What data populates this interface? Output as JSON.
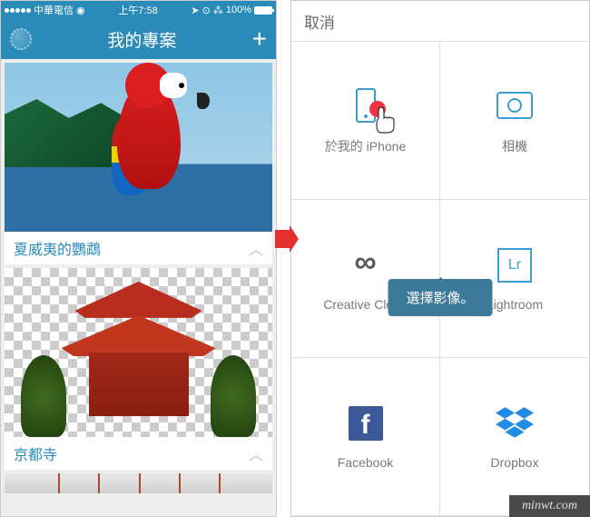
{
  "status": {
    "carrier": "中華電信",
    "wifi": "⋮",
    "time": "上午7:58",
    "battery_pct": "100%"
  },
  "left": {
    "title": "我的專案",
    "projects": [
      {
        "title": "夏威夷的鸚鵡"
      },
      {
        "title": "京都寺"
      }
    ]
  },
  "right": {
    "cancel": "取消",
    "tooltip": "選擇影像。",
    "sources": [
      {
        "label": "於我的 iPhone",
        "icon": "phone-icon"
      },
      {
        "label": "相機",
        "icon": "camera-icon"
      },
      {
        "label": "Creative Cloud",
        "icon": "creative-cloud-icon"
      },
      {
        "label": "Lightroom",
        "icon": "lightroom-icon",
        "badge": "Lr"
      },
      {
        "label": "Facebook",
        "icon": "facebook-icon",
        "badge": "f"
      },
      {
        "label": "Dropbox",
        "icon": "dropbox-icon"
      }
    ]
  },
  "watermark": "minwt.com"
}
